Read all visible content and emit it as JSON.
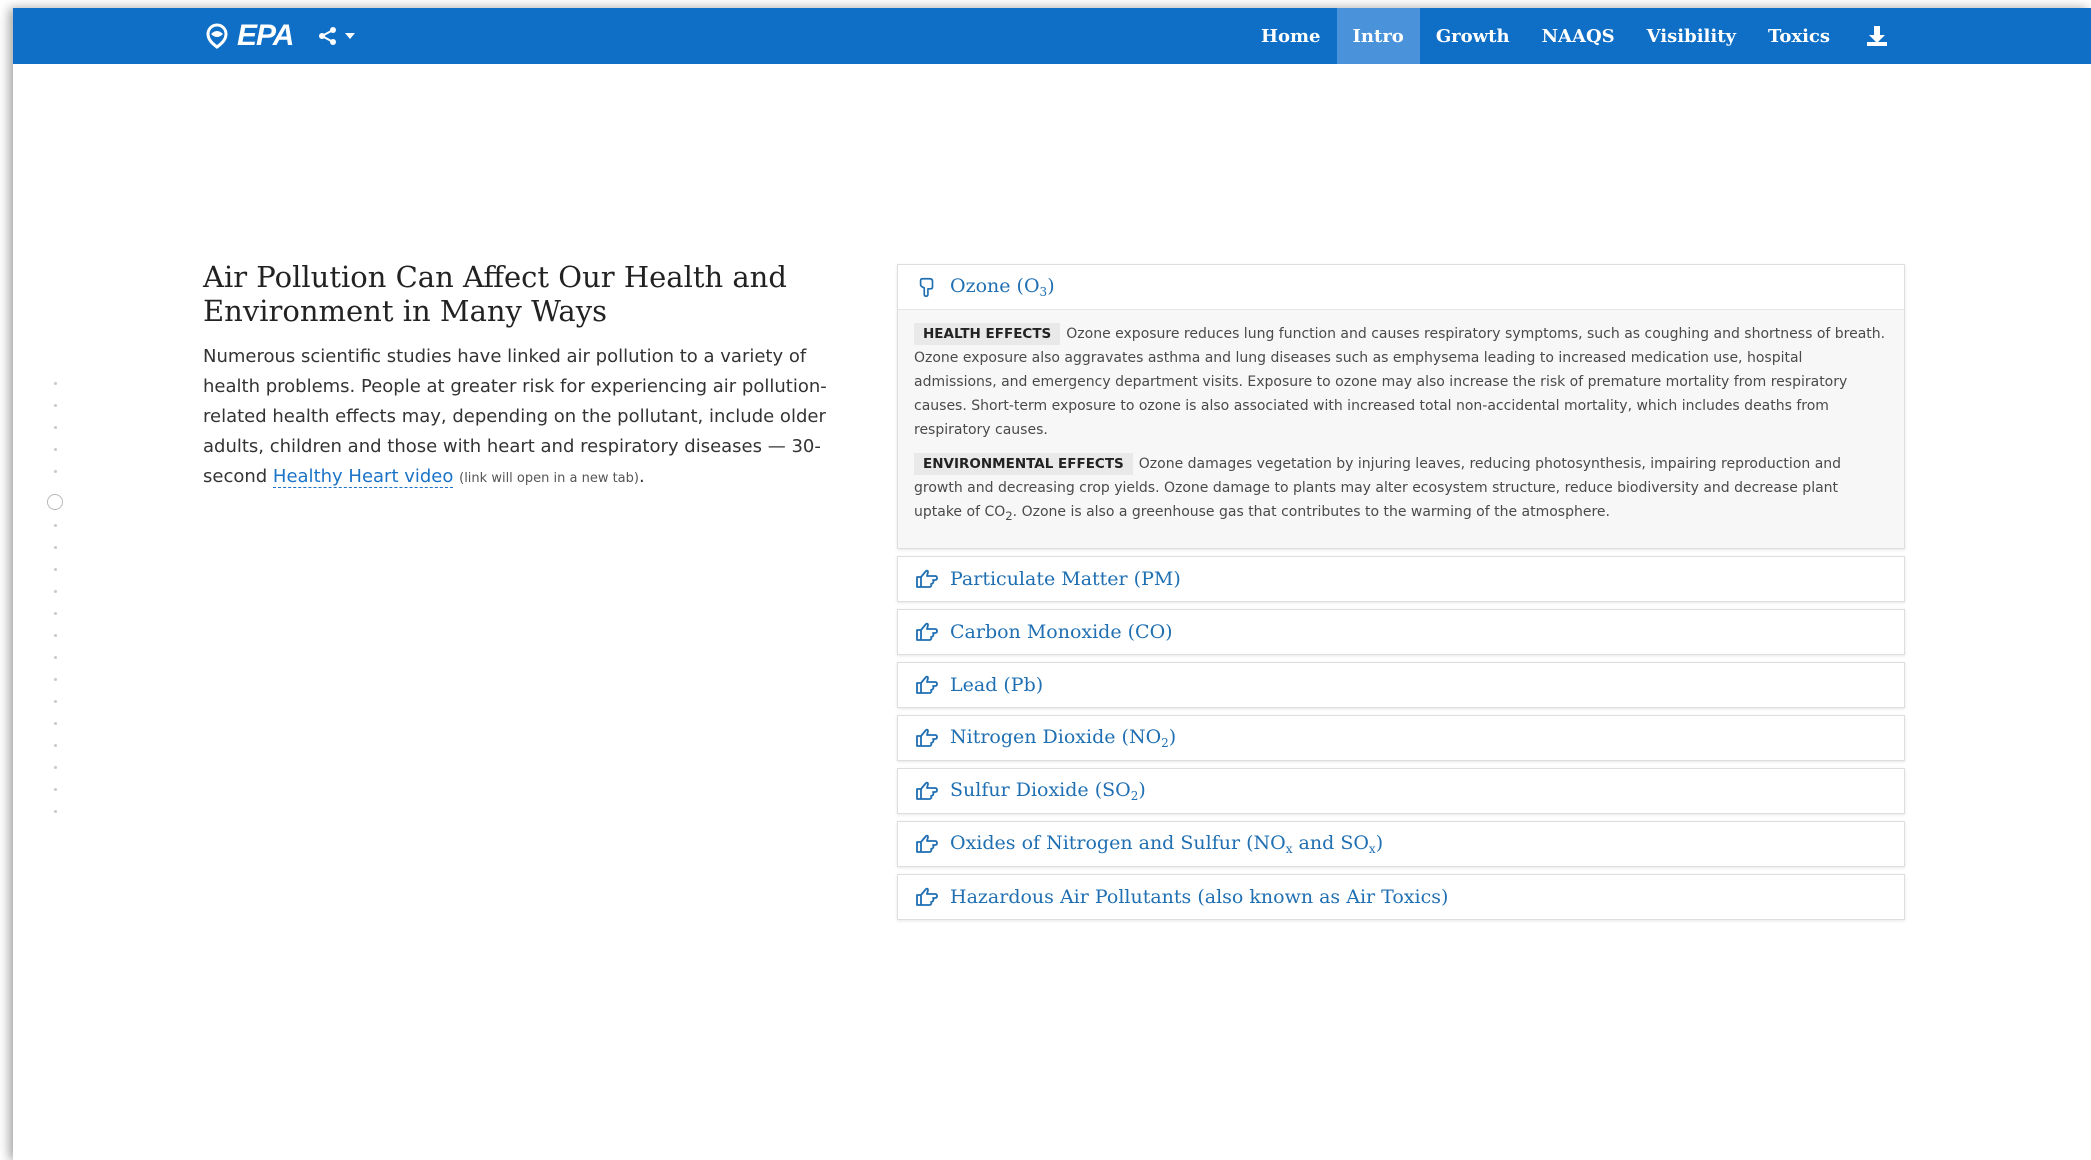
{
  "brand": {
    "logo_text": "EPA"
  },
  "nav": {
    "items": [
      {
        "label": "Home",
        "active": false
      },
      {
        "label": "Intro",
        "active": true
      },
      {
        "label": "Growth",
        "active": false
      },
      {
        "label": "NAAQS",
        "active": false
      },
      {
        "label": "Visibility",
        "active": false
      },
      {
        "label": "Toxics",
        "active": false
      }
    ],
    "share_icon": "share-icon",
    "download_icon": "download-icon"
  },
  "intro": {
    "title": "Air Pollution Can Affect Our Health and Environment in Many Ways",
    "body": "Numerous scientific studies have linked air pollution to a variety of health problems. People at greater risk for experiencing air pollution-related health effects may, depending on the pollutant, include older adults, children and those with heart and respiratory diseases — 30-second ",
    "link_text": "Healthy Heart video",
    "link_note": "(link will open in a new tab)",
    "trailing": "."
  },
  "pollutants": {
    "ozone": {
      "title": "Ozone (O",
      "sub": "3",
      "title_end": ")",
      "health_tag": "HEALTH EFFECTS",
      "health_text": "Ozone exposure reduces lung function and causes respiratory symptoms, such as coughing and shortness of breath. Ozone exposure also aggravates asthma and lung diseases such as emphysema leading to increased medication use, hospital admissions, and emergency department visits. Exposure to ozone may also increase the risk of premature mortality from respiratory causes. Short-term exposure to ozone is also associated with increased total non-accidental mortality, which includes deaths from respiratory causes.",
      "env_tag": "ENVIRONMENTAL EFFECTS",
      "env_text_a": "Ozone damages vegetation by injuring leaves, reducing photosynthesis, impairing reproduction and growth and decreasing crop yields. Ozone damage to plants may alter ecosystem structure, reduce biodiversity and decrease plant uptake of CO",
      "env_sub": "2",
      "env_text_b": ". Ozone is also a greenhouse gas that contributes to the warming of the atmosphere."
    },
    "pm": {
      "title": "Particulate Matter (PM)"
    },
    "co": {
      "title": "Carbon Monoxide (CO)"
    },
    "pb": {
      "title": "Lead (Pb)"
    },
    "no2": {
      "title": "Nitrogen Dioxide (NO",
      "sub": "2",
      "end": ")"
    },
    "so2": {
      "title": "Sulfur Dioxide (SO",
      "sub": "2",
      "end": ")"
    },
    "noxsox": {
      "a": "Oxides of Nitrogen and Sulfur (NO",
      "sub1": "x",
      "b": " and SO",
      "sub2": "x",
      "end": ")"
    },
    "haps": {
      "title": "Hazardous Air Pollutants (also known as Air Toxics)"
    }
  },
  "colors": {
    "navbar": "#0f6fc6",
    "active_tab": "#4a93da",
    "link": "#1f6fb2"
  }
}
